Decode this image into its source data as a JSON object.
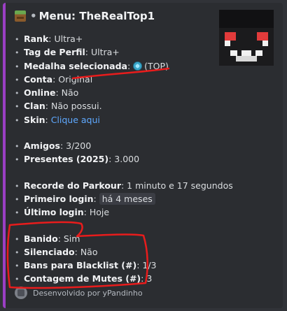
{
  "colors": {
    "accent": "#9b3fc4",
    "link": "#5fa9ff",
    "annotation": "#e81c1c"
  },
  "title": {
    "icon": "grass-block-icon",
    "dot": "•",
    "text": "Menu: TheRealTop1"
  },
  "thumbnail": {
    "icon": "player-head-skin-icon"
  },
  "fields": {
    "rank": {
      "label": "Rank",
      "value": "Ultra+"
    },
    "tag": {
      "label": "Tag de Perfil",
      "value": "Ultra+"
    },
    "medal": {
      "label": "Medalha selecionada",
      "icon": "medal-icon",
      "value": "(TOP)"
    },
    "account": {
      "label": "Conta",
      "value": "Original"
    },
    "online": {
      "label": "Online",
      "value": "Não"
    },
    "clan": {
      "label": "Clan",
      "value": "Não possui."
    },
    "skin": {
      "label": "Skin",
      "value": "Clique aqui"
    },
    "friends": {
      "label": "Amigos",
      "value": "3/200"
    },
    "gifts": {
      "label": "Presentes (2025)",
      "value": "3.000"
    },
    "parkour": {
      "label": "Recorde do Parkour",
      "value": "1 minuto e 17 segundos"
    },
    "first_login": {
      "label": "Primeiro login",
      "value": "há 4 meses"
    },
    "last_login": {
      "label": "Último login",
      "value": "Hoje"
    },
    "banned": {
      "label": "Banido",
      "value": "Sim"
    },
    "muted": {
      "label": "Silenciado",
      "value": "Não"
    },
    "blacklist": {
      "label": "Bans para Blacklist (#)",
      "value": "1/3"
    },
    "mute_count": {
      "label": "Contagem de Mutes (#)",
      "value": "3"
    }
  },
  "footer": {
    "text": "Desenvolvido por yPandinho"
  }
}
